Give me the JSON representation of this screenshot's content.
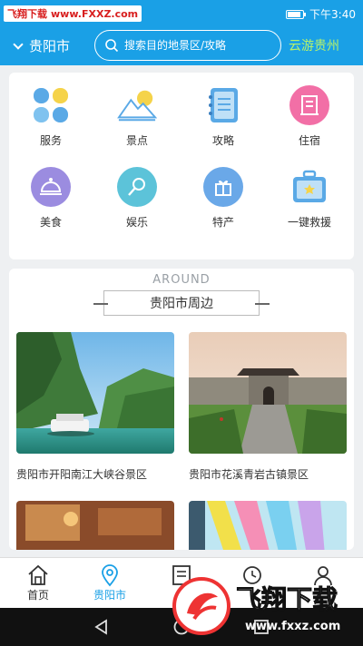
{
  "status": {
    "watermark_left": "飞翔下载",
    "watermark_url": "www.FXXZ.com",
    "time": "下午3:40",
    "battery_level": 0.85
  },
  "header": {
    "city": "贵阳市",
    "search_placeholder": "搜索目的地景区/攻略",
    "brand": "云游贵州"
  },
  "menu": [
    {
      "label": "服务",
      "icon": "grid-icon",
      "color": "#5aa9e6"
    },
    {
      "label": "景点",
      "icon": "mountain-icon",
      "color": "#5aa9e6"
    },
    {
      "label": "攻略",
      "icon": "notebook-icon",
      "color": "#5aa9e6"
    },
    {
      "label": "住宿",
      "icon": "building-icon",
      "color": "#f26fa6"
    },
    {
      "label": "美食",
      "icon": "food-cover-icon",
      "color": "#9b8ce0"
    },
    {
      "label": "娱乐",
      "icon": "microphone-icon",
      "color": "#5cc3d9"
    },
    {
      "label": "特产",
      "icon": "gift-icon",
      "color": "#6aa8e8"
    },
    {
      "label": "一键救援",
      "icon": "first-aid-kit-icon",
      "color": "#5aa9e6"
    }
  ],
  "around": {
    "title_en": "AROUND",
    "title_zh": "贵阳市周边",
    "items": [
      {
        "name": "贵阳市开阳南江大峡谷景区"
      },
      {
        "name": "贵阳市花溪青岩古镇景区"
      },
      {
        "name": ""
      },
      {
        "name": ""
      }
    ]
  },
  "tabs": [
    {
      "label": "首页",
      "icon": "home-icon"
    },
    {
      "label": "贵阳市",
      "icon": "location-pin-icon"
    },
    {
      "label": "",
      "icon": "news-icon"
    },
    {
      "label": "",
      "icon": "clock-icon"
    },
    {
      "label": "",
      "icon": "user-icon"
    }
  ],
  "logo_watermark": {
    "text_zh": "飞翔下载",
    "url": "www.fxxz.com"
  },
  "colors": {
    "primary": "#1aa0e6",
    "brand": "#b7f26b"
  }
}
